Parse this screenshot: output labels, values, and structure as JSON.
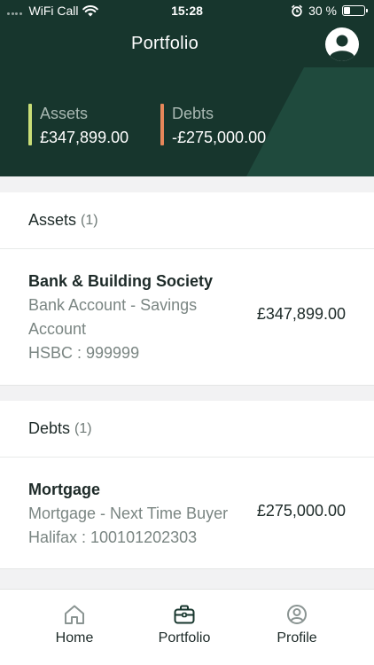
{
  "status_bar": {
    "carrier": "WiFi Call",
    "time": "15:28",
    "battery": "30 %",
    "battery_level": 0.3
  },
  "header": {
    "title": "Portfolio",
    "assets_label": "Assets",
    "assets_value": "£347,899.00",
    "debts_label": "Debts",
    "debts_value": "-£275,000.00"
  },
  "colors": {
    "header_bg": "#17362d",
    "assets_accent": "#c9dd77",
    "debts_accent": "#e6875a",
    "active_tab": "#17362d"
  },
  "assets_section": {
    "title": "Assets",
    "count": "(1)",
    "items": [
      {
        "name": "Bank & Building Society",
        "line1": "Bank Account - Savings Account",
        "line2": "HSBC : 999999",
        "amount": "£347,899.00"
      }
    ]
  },
  "debts_section": {
    "title": "Debts",
    "count": "(1)",
    "items": [
      {
        "name": "Mortgage",
        "line1": "Mortgage - Next Time Buyer",
        "line2": "Halifax : 100101202303",
        "amount": "£275,000.00"
      }
    ]
  },
  "tabs": [
    {
      "label": "Home",
      "icon": "home-icon",
      "active": false
    },
    {
      "label": "Portfolio",
      "icon": "briefcase-icon",
      "active": true
    },
    {
      "label": "Profile",
      "icon": "user-circle-icon",
      "active": false
    }
  ]
}
